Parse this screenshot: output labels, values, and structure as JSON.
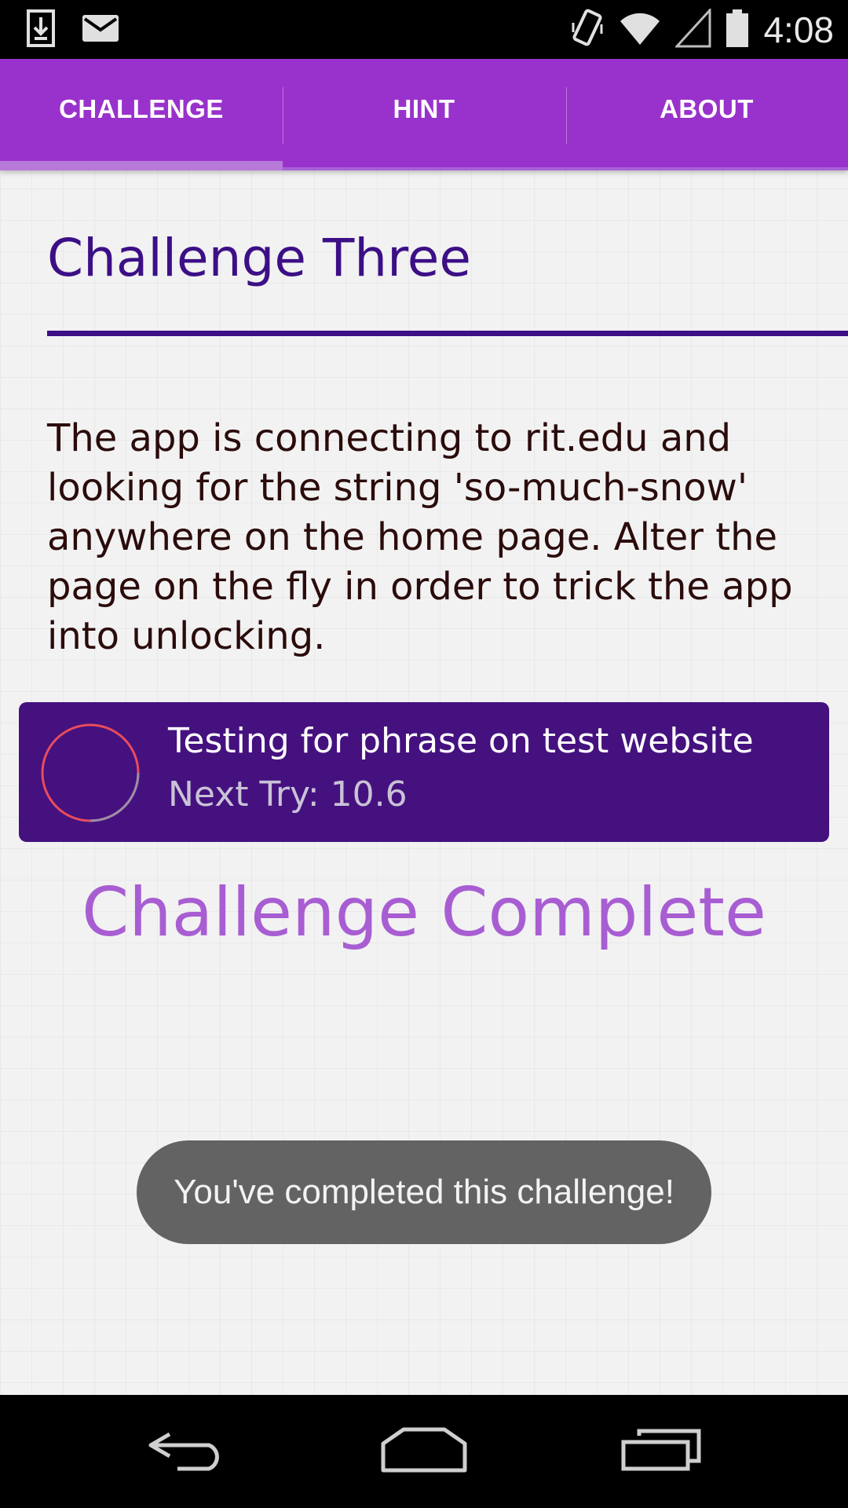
{
  "status_bar": {
    "time": "4:08",
    "icons": [
      "download-icon",
      "mail-icon",
      "vibrate-icon",
      "wifi-icon",
      "signal-icon",
      "battery-icon"
    ]
  },
  "tabs": [
    {
      "label": "CHALLENGE",
      "selected": true
    },
    {
      "label": "HINT",
      "selected": false
    },
    {
      "label": "ABOUT",
      "selected": false
    }
  ],
  "challenge": {
    "title": "Challenge Three",
    "description": "The app is connecting to rit.edu and looking for the string 'so-much-snow' anywhere on the home page. Alter the page on the fly in order to trick the app into unlocking."
  },
  "status_card": {
    "title": "Testing for phrase on test website",
    "subtitle": "Next Try: 10.6"
  },
  "complete_label": "Challenge Complete",
  "toast": {
    "message": "You've completed this challenge!"
  },
  "nav_bar": {
    "icons": [
      "back-icon",
      "home-icon",
      "recents-icon"
    ]
  },
  "colors": {
    "tab_bar": "#9932cc",
    "tab_indicator": "#b77ad9",
    "title": "#3c0f86",
    "card_background": "#45117f",
    "complete_text": "#a85ed2",
    "toast_background": "#636363",
    "spinner": "#e84c5c"
  }
}
